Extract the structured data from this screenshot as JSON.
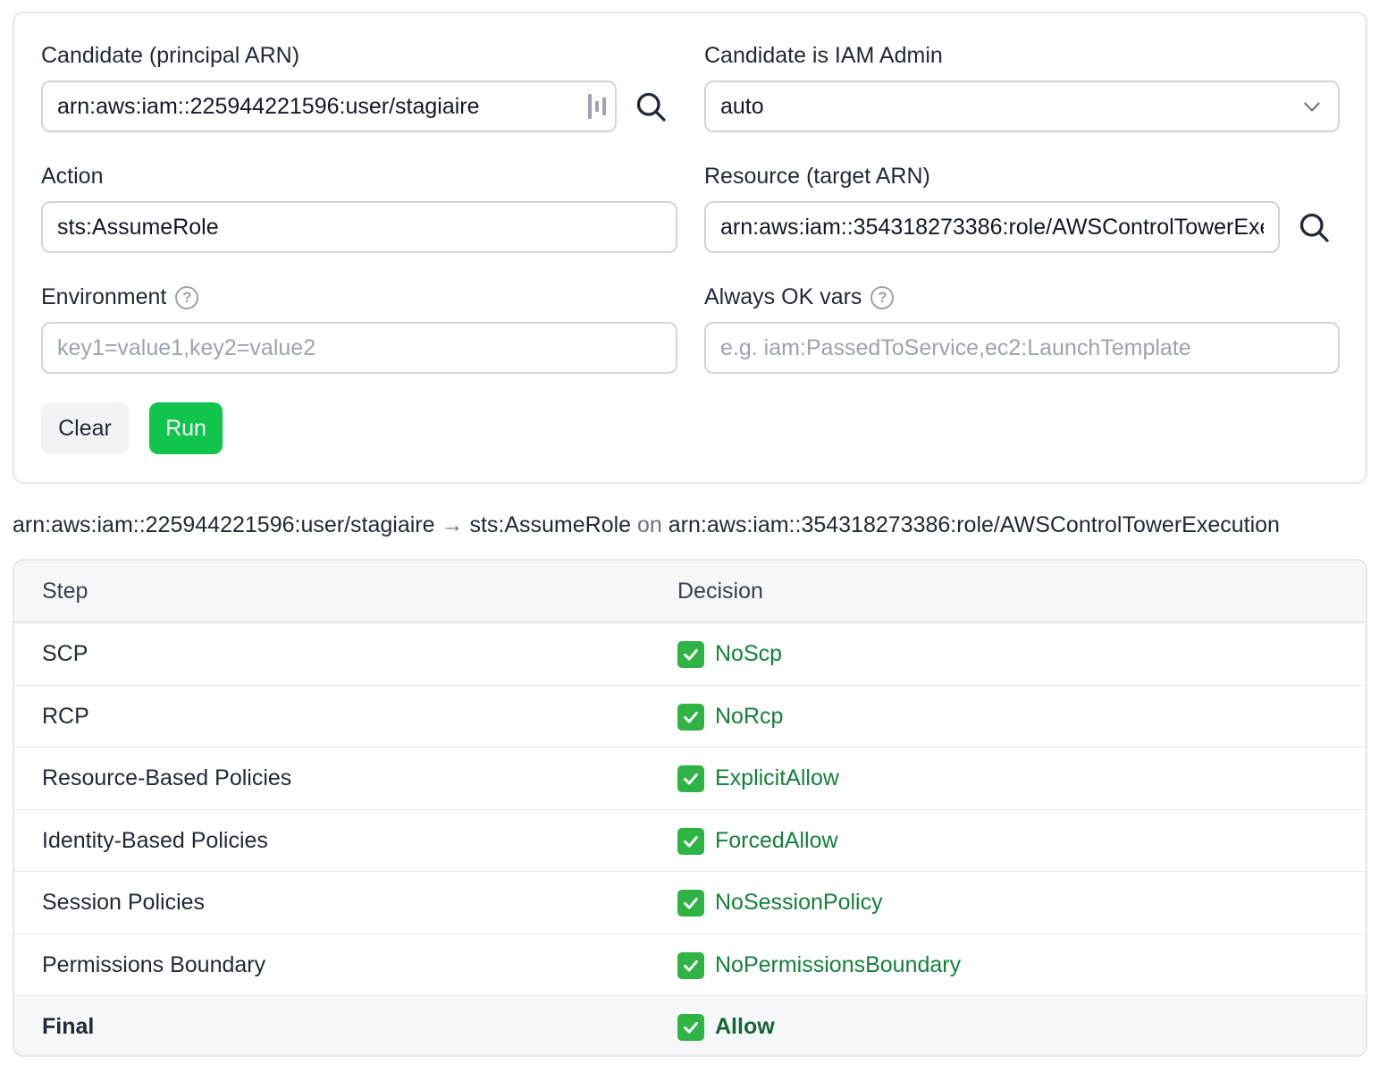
{
  "form": {
    "candidate": {
      "label": "Candidate (principal ARN)",
      "value": "arn:aws:iam::225944221596:user/stagiaire"
    },
    "iam_admin": {
      "label": "Candidate is IAM Admin",
      "value": "auto"
    },
    "action": {
      "label": "Action",
      "value": "sts:AssumeRole"
    },
    "resource": {
      "label": "Resource (target ARN)",
      "value": "arn:aws:iam::354318273386:role/AWSControlTowerExecution"
    },
    "environment": {
      "label": "Environment",
      "placeholder": "key1=value1,key2=value2"
    },
    "always_ok": {
      "label": "Always OK vars",
      "placeholder": "e.g. iam:PassedToService,ec2:LaunchTemplate"
    },
    "buttons": {
      "clear": "Clear",
      "run": "Run"
    }
  },
  "summary": {
    "principal": "arn:aws:iam::225944221596:user/stagiaire",
    "arrow": "→",
    "action": "sts:AssumeRole",
    "on": "on",
    "resource": "arn:aws:iam::354318273386:role/AWSControlTowerExecution"
  },
  "table": {
    "headers": {
      "step": "Step",
      "decision": "Decision"
    },
    "rows": [
      {
        "step": "SCP",
        "decision": "NoScp"
      },
      {
        "step": "RCP",
        "decision": "NoRcp"
      },
      {
        "step": "Resource-Based Policies",
        "decision": "ExplicitAllow"
      },
      {
        "step": "Identity-Based Policies",
        "decision": "ForcedAllow"
      },
      {
        "step": "Session Policies",
        "decision": "NoSessionPolicy"
      },
      {
        "step": "Permissions Boundary",
        "decision": "NoPermissionsBoundary"
      }
    ],
    "final": {
      "step": "Final",
      "decision": "Allow"
    }
  },
  "colors": {
    "run_button": "#10c44c",
    "decision_text": "#15803d",
    "check_badge": "#2fb344"
  },
  "icons": {
    "search": "search-icon",
    "chevron": "chevron-down-icon",
    "help": "help-circle-icon",
    "check": "check-mark-button-icon",
    "bars": "password-manager-icon"
  }
}
